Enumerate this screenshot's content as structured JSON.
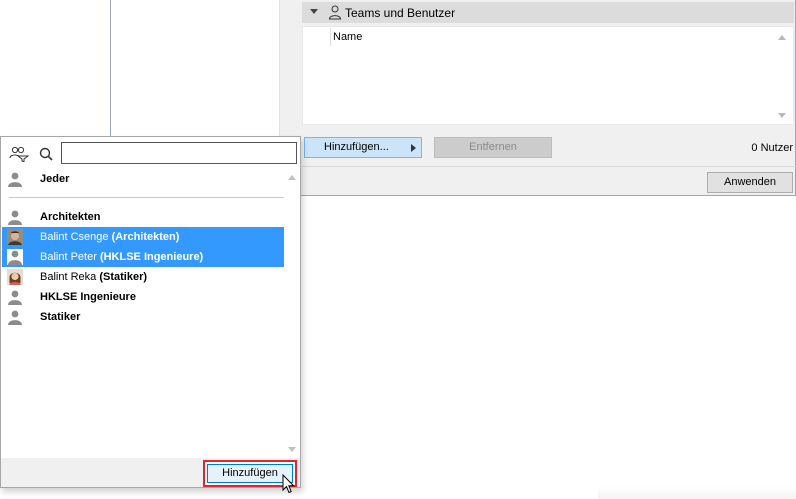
{
  "dialog": {
    "section_title": "Teams und Benutzer",
    "column_header": "Name",
    "add_button": "Hinzufügen...",
    "remove_button": "Entfernen",
    "count_label": "0 Nutzer",
    "apply_button": "Anwenden"
  },
  "popup": {
    "search_value": "",
    "items": [
      {
        "name": "Jeder",
        "bold": "",
        "selected": false,
        "avatar": "generic-user"
      },
      {
        "name": "Architekten",
        "bold": "",
        "selected": false,
        "avatar": "generic-user"
      },
      {
        "name": "Balint Csenge",
        "bold": "(Architekten)",
        "selected": true,
        "avatar": "photo-male"
      },
      {
        "name": "Balint Peter",
        "bold": "(HKLSE Ingenieure)",
        "selected": true,
        "avatar": "generic-user"
      },
      {
        "name": "Balint Reka",
        "bold": "(Statiker)",
        "selected": false,
        "avatar": "photo-female"
      },
      {
        "name": "HKLSE Ingenieure",
        "bold": "",
        "selected": false,
        "avatar": "generic-user"
      },
      {
        "name": "Statiker",
        "bold": "",
        "selected": false,
        "avatar": "generic-user"
      }
    ],
    "add_button": "Hinzufügen"
  },
  "colors": {
    "selection": "#3399ff",
    "highlight_frame": "#e0252b",
    "section_header_bg": "#dcdcdc"
  }
}
